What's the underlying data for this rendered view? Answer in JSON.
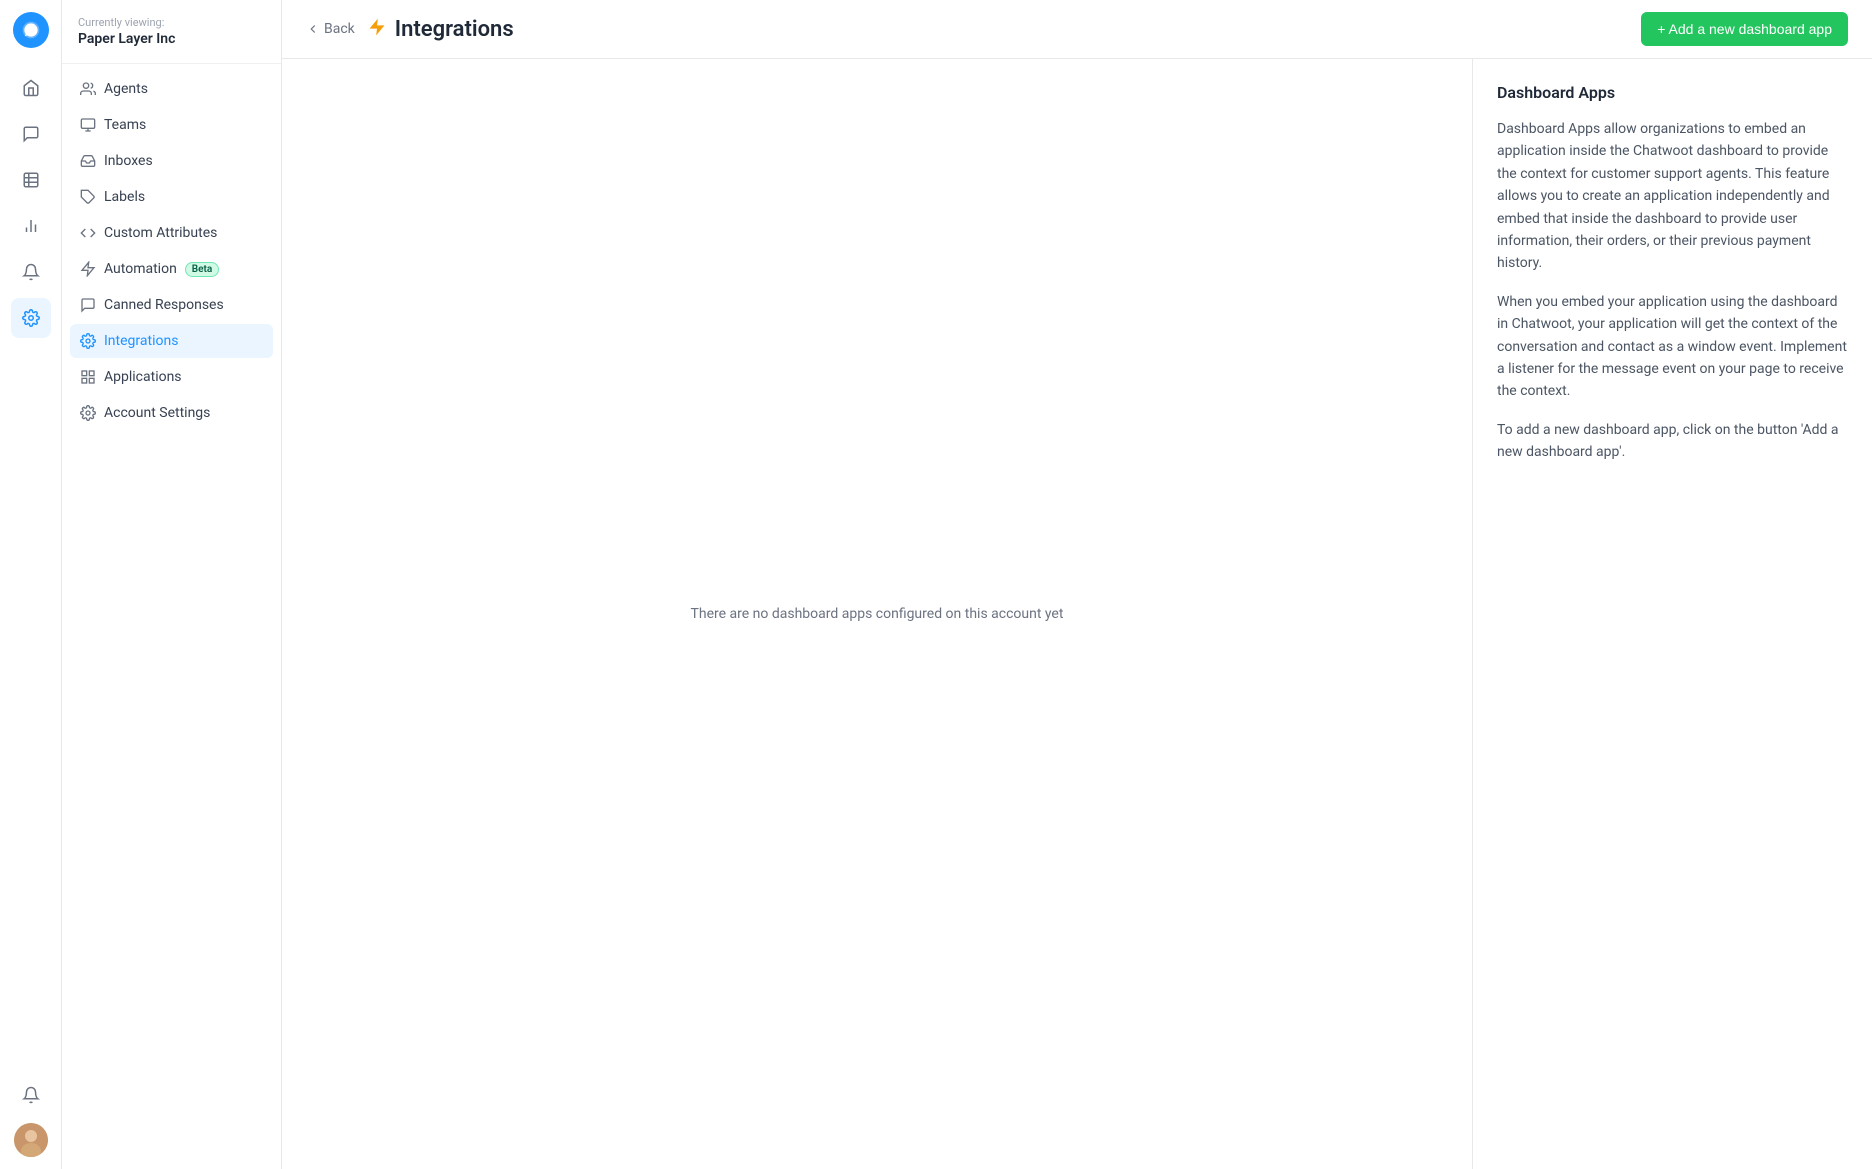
{
  "iconbar": {
    "logo_alt": "Chatwoot Logo"
  },
  "sidebar": {
    "currently_viewing_label": "Currently viewing:",
    "account_name": "Paper Layer Inc",
    "nav_items": [
      {
        "id": "agents",
        "label": "Agents",
        "icon": "users-icon"
      },
      {
        "id": "teams",
        "label": "Teams",
        "icon": "team-icon"
      },
      {
        "id": "inboxes",
        "label": "Inboxes",
        "icon": "inbox-icon"
      },
      {
        "id": "labels",
        "label": "Labels",
        "icon": "tag-icon"
      },
      {
        "id": "custom-attributes",
        "label": "Custom Attributes",
        "icon": "attribute-icon"
      },
      {
        "id": "automation",
        "label": "Automation",
        "icon": "automation-icon",
        "badge": "Beta"
      },
      {
        "id": "canned-responses",
        "label": "Canned Responses",
        "icon": "canned-icon"
      },
      {
        "id": "integrations",
        "label": "Integrations",
        "icon": "integrations-icon",
        "active": true
      },
      {
        "id": "applications",
        "label": "Applications",
        "icon": "applications-icon"
      },
      {
        "id": "account-settings",
        "label": "Account Settings",
        "icon": "settings-icon"
      }
    ]
  },
  "topbar": {
    "back_label": "Back",
    "page_title": "Integrations",
    "add_button_label": "+ Add a new dashboard app"
  },
  "main": {
    "empty_state": "There are no dashboard apps configured on this account yet"
  },
  "info_panel": {
    "title": "Dashboard Apps",
    "paragraph1": "Dashboard Apps allow organizations to embed an application inside the Chatwoot dashboard to provide the context for customer support agents. This feature allows you to create an application independently and embed that inside the dashboard to provide user information, their orders, or their previous payment history.",
    "paragraph2": "When you embed your application using the dashboard in Chatwoot, your application will get the context of the conversation and contact as a window event. Implement a listener for the message event on your page to receive the context.",
    "paragraph3": "To add a new dashboard app, click on the button 'Add a new dashboard app'."
  }
}
